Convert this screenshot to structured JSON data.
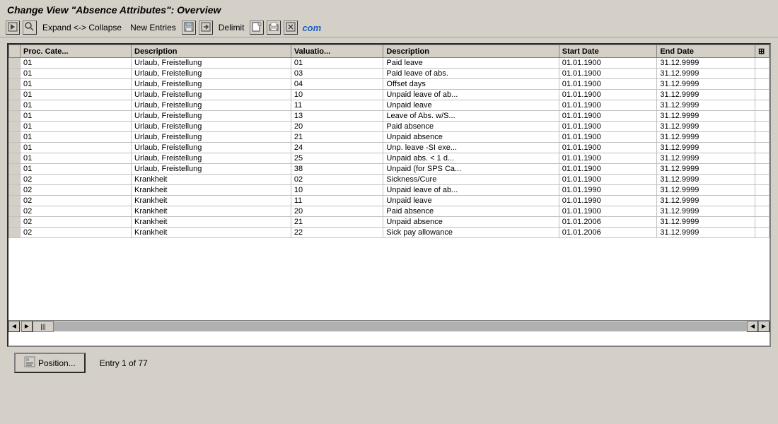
{
  "window": {
    "title": "Change View \"Absence Attributes\": Overview"
  },
  "toolbar": {
    "expand_collapse_label": "Expand <-> Collapse",
    "new_entries_label": "New Entries",
    "delimit_label": "Delimit",
    "com_text": "com"
  },
  "table": {
    "columns": [
      {
        "id": "proc_cate",
        "label": "Proc. Cate..."
      },
      {
        "id": "description1",
        "label": "Description"
      },
      {
        "id": "valuation",
        "label": "Valuatio..."
      },
      {
        "id": "description2",
        "label": "Description"
      },
      {
        "id": "start_date",
        "label": "Start Date"
      },
      {
        "id": "end_date",
        "label": "End Date"
      }
    ],
    "rows": [
      {
        "proc_cate": "01",
        "description1": "Urlaub, Freistellung",
        "valuation": "01",
        "description2": "Paid leave",
        "start_date": "01.01.1900",
        "end_date": "31.12.9999"
      },
      {
        "proc_cate": "01",
        "description1": "Urlaub, Freistellung",
        "valuation": "03",
        "description2": "Paid leave of abs.",
        "start_date": "01.01.1900",
        "end_date": "31.12.9999"
      },
      {
        "proc_cate": "01",
        "description1": "Urlaub, Freistellung",
        "valuation": "04",
        "description2": "Offset days",
        "start_date": "01.01.1900",
        "end_date": "31.12.9999"
      },
      {
        "proc_cate": "01",
        "description1": "Urlaub, Freistellung",
        "valuation": "10",
        "description2": "Unpaid leave of ab...",
        "start_date": "01.01.1900",
        "end_date": "31.12.9999"
      },
      {
        "proc_cate": "01",
        "description1": "Urlaub, Freistellung",
        "valuation": "11",
        "description2": "Unpaid leave",
        "start_date": "01.01.1900",
        "end_date": "31.12.9999"
      },
      {
        "proc_cate": "01",
        "description1": "Urlaub, Freistellung",
        "valuation": "13",
        "description2": "Leave of Abs. w/S...",
        "start_date": "01.01.1900",
        "end_date": "31.12.9999"
      },
      {
        "proc_cate": "01",
        "description1": "Urlaub, Freistellung",
        "valuation": "20",
        "description2": "Paid absence",
        "start_date": "01.01.1900",
        "end_date": "31.12.9999"
      },
      {
        "proc_cate": "01",
        "description1": "Urlaub, Freistellung",
        "valuation": "21",
        "description2": "Unpaid absence",
        "start_date": "01.01.1900",
        "end_date": "31.12.9999"
      },
      {
        "proc_cate": "01",
        "description1": "Urlaub, Freistellung",
        "valuation": "24",
        "description2": "Unp. leave -SI exe...",
        "start_date": "01.01.1900",
        "end_date": "31.12.9999"
      },
      {
        "proc_cate": "01",
        "description1": "Urlaub, Freistellung",
        "valuation": "25",
        "description2": "Unpaid abs. < 1 d...",
        "start_date": "01.01.1900",
        "end_date": "31.12.9999"
      },
      {
        "proc_cate": "01",
        "description1": "Urlaub, Freistellung",
        "valuation": "38",
        "description2": "Unpaid (for SPS Ca...",
        "start_date": "01.01.1900",
        "end_date": "31.12.9999"
      },
      {
        "proc_cate": "02",
        "description1": "Krankheit",
        "valuation": "02",
        "description2": "Sickness/Cure",
        "start_date": "01.01.1900",
        "end_date": "31.12.9999"
      },
      {
        "proc_cate": "02",
        "description1": "Krankheit",
        "valuation": "10",
        "description2": "Unpaid leave of ab...",
        "start_date": "01.01.1990",
        "end_date": "31.12.9999"
      },
      {
        "proc_cate": "02",
        "description1": "Krankheit",
        "valuation": "11",
        "description2": "Unpaid leave",
        "start_date": "01.01.1990",
        "end_date": "31.12.9999"
      },
      {
        "proc_cate": "02",
        "description1": "Krankheit",
        "valuation": "20",
        "description2": "Paid absence",
        "start_date": "01.01.1900",
        "end_date": "31.12.9999"
      },
      {
        "proc_cate": "02",
        "description1": "Krankheit",
        "valuation": "21",
        "description2": "Unpaid absence",
        "start_date": "01.01.2006",
        "end_date": "31.12.9999"
      },
      {
        "proc_cate": "02",
        "description1": "Krankheit",
        "valuation": "22",
        "description2": "Sick pay allowance",
        "start_date": "01.01.2006",
        "end_date": "31.12.9999"
      }
    ]
  },
  "bottom": {
    "position_btn_label": "Position...",
    "entry_info": "Entry 1 of 77"
  },
  "icons": {
    "execute": "⚙",
    "find": "🔍",
    "expand_icon": "↔",
    "new_entries_icon": "📋",
    "save_icon": "💾",
    "delimit_icon": "✂",
    "local_file_icon": "📁",
    "print_icon": "🖨",
    "exit_icon": "🚪",
    "grid_settings": "⊞",
    "position_icon": "📍",
    "scroll_up": "▲",
    "scroll_down": "▼",
    "scroll_left": "◀",
    "scroll_right": "▶"
  }
}
